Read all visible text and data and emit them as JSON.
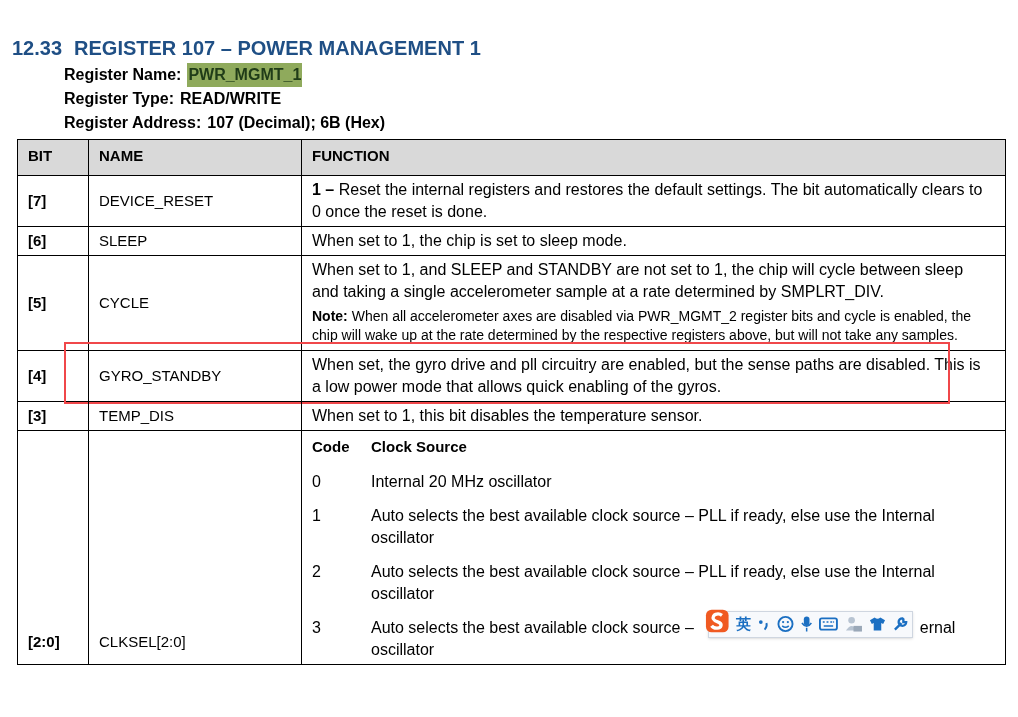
{
  "section": {
    "number": "12.33",
    "title": "REGISTER 107 – POWER MANAGEMENT 1"
  },
  "register_info": [
    {
      "label": "Register Name:",
      "value": "PWR_MGMT_1",
      "highlighted": true
    },
    {
      "label": "Register Type:",
      "value": "READ/WRITE",
      "highlighted": false
    },
    {
      "label": "Register Address:",
      "value": "107 (Decimal); 6B (Hex)",
      "highlighted": false
    }
  ],
  "table": {
    "columns": [
      "BIT",
      "NAME",
      "FUNCTION"
    ],
    "rows": [
      {
        "kind": "text",
        "bit": "[7]",
        "name": "DEVICE_RESET",
        "marked": false,
        "function": [
          {
            "kind": "text",
            "text": "**1 –** Reset the internal registers and restores the default settings.  The bit automatically clears to 0 once the reset is done."
          }
        ]
      },
      {
        "kind": "text",
        "bit": "[6]",
        "name": "SLEEP",
        "marked": false,
        "function": [
          {
            "kind": "text",
            "text": "When set to 1, the chip is set to sleep mode."
          }
        ]
      },
      {
        "kind": "text",
        "bit": "[5]",
        "name": "CYCLE",
        "marked": false,
        "function": [
          {
            "kind": "text",
            "text": "When set to 1, and SLEEP and STANDBY are not set to 1, the chip will cycle between sleep and taking a single accelerometer sample at a rate determined by SMPLRT_DIV."
          },
          {
            "kind": "note",
            "text": "**Note:**  When all accelerometer axes are disabled via PWR_MGMT_2 register bits and cycle is enabled, the chip will wake up at the rate determined by the respective registers above, but will not take any samples."
          }
        ]
      },
      {
        "kind": "text",
        "bit": "[4]",
        "name": "GYRO_STANDBY",
        "marked": true,
        "function": [
          {
            "kind": "text",
            "text": "When set, the gyro drive and pll circuitry are enabled, but the sense paths are disabled.  This is a low power mode that allows quick enabling of the gyros."
          }
        ]
      },
      {
        "kind": "text",
        "bit": "[3]",
        "name": "TEMP_DIS",
        "marked": false,
        "function": [
          {
            "kind": "text",
            "text": "When set to 1, this bit disables the temperature sensor."
          }
        ]
      },
      {
        "kind": "clock_table",
        "bit": "[2:0]",
        "name": "CLKSEL[2:0]",
        "marked": false,
        "clock_columns": [
          "Code",
          "Clock Source"
        ],
        "clock_rows": [
          {
            "code": "0",
            "source": "Internal 20 MHz oscillator"
          },
          {
            "code": "1",
            "source": "Auto selects the best available clock source – PLL if ready, else use the Internal oscillator"
          },
          {
            "code": "2",
            "source": "Auto selects the best available clock source – PLL if ready, else use the Internal oscillator"
          },
          {
            "code": "3",
            "kind": "partly_covered",
            "source": "Auto selects the best available clock source –",
            "tail": "ernal",
            "second_line": "oscillator"
          }
        ]
      }
    ]
  },
  "ime_toolbar": {
    "language": "英"
  }
}
